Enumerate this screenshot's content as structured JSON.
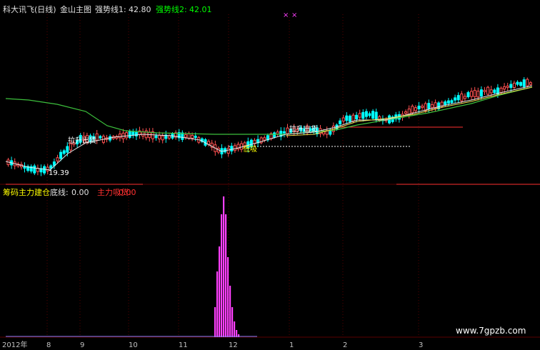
{
  "top_header": {
    "title": "科大讯飞(日线)",
    "indicator": "金山主图",
    "line1_label": "强势线1:",
    "line1_value": "42.80",
    "line2_label": "强势线2:",
    "line2_value": "42.01"
  },
  "price_panel": {
    "annotations": {
      "rise_out": "拉升出货",
      "low_point": "19.39",
      "low_absorb": "低吸",
      "bottom_out": "拉升出货"
    }
  },
  "indicator_panel": {
    "title": "筹码主力建仓",
    "bottom_line_label": "底线:",
    "bottom_line_value": "0.00",
    "main_build_label": "主力吸货:",
    "main_build_value": "0.00"
  },
  "x_axis": {
    "ticks": [
      "2012年",
      "8",
      "9",
      "10",
      "11",
      "12",
      "1",
      "2",
      "3"
    ]
  },
  "watermark": "www.7gpzb.com",
  "colors": {
    "up": "#ff5050",
    "down": "#00ffff",
    "ma_white": "#e8e8e8",
    "ma_green": "#3cbf3c",
    "ma_yellow": "#f0e050",
    "volume": "#ff40ff",
    "grid": "#5a0000",
    "header_white": "#e0e0e0",
    "header_yellow": "#ffff00",
    "header_green": "#00ff00",
    "header_red": "#ff3030"
  }
}
